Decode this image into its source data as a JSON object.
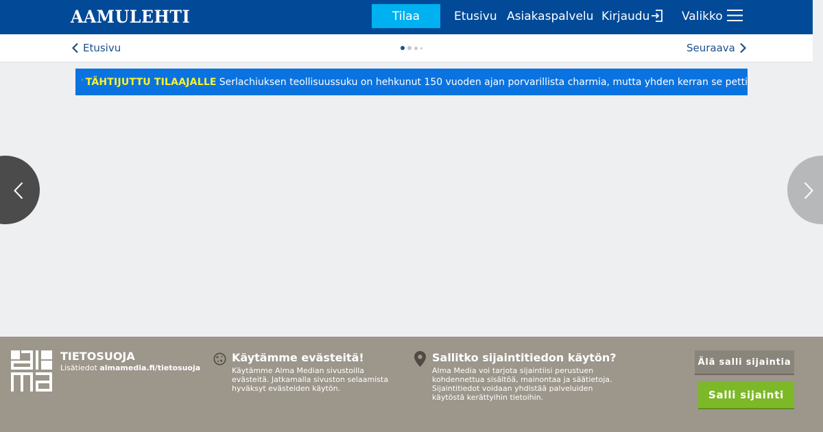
{
  "header": {
    "logo": "AAMULEHTI",
    "subscribe_label": "Tilaa",
    "nav": {
      "front_page": "Etusivu",
      "customer_service": "Asiakaspalvelu",
      "login": "Kirjaudu",
      "menu": "Valikko"
    },
    "icons": {
      "login": "login-icon",
      "menu": "hamburger-menu-icon"
    }
  },
  "subnav": {
    "back_label": "Etusivu",
    "next_label": "Seuraava",
    "pager": {
      "total_dots": 4,
      "active_index": 0
    }
  },
  "teaser": {
    "label": "TÄHTIJUTTU TILAAJALLE",
    "text": "Serlachiuksen teollisuussuku on hehkunut 150 vuoden ajan porvarillista charmia, mutta yhden kerran se petti",
    "icon": "star-icon"
  },
  "consent": {
    "privacy": {
      "title": "TIETOSUOJA",
      "prefix": "Lisätiedot",
      "link": "almamedia.fi/tietosuoja"
    },
    "cookies": {
      "title": "Käytämme evästeitä!",
      "text": "Käytämme Alma Median sivustoilla evästeitä. Jatkamalla sivuston selaamista hyväksyt evästeiden käytön."
    },
    "location": {
      "title": "Sallitko sijaintitiedon käytön?",
      "text": "Alma Media voi tarjota sijaintiisi perustuen kohdennettua sisältöä, mainontaa ja säätietoja. Sijaintitiedot voidaan yhdistää palveluiden käytöstä kerättyihin tietoihin."
    },
    "deny_label": "Älä salli sijaintia",
    "allow_label": "Salli sijainti"
  },
  "colors": {
    "header_bg": "#024a98",
    "subscribe_bg": "#00b1f2",
    "teaser_bg": "#0a73e0",
    "teaser_label": "#fff22a",
    "consent_bg": "#9c968b",
    "allow_bg": "#7cb828"
  }
}
